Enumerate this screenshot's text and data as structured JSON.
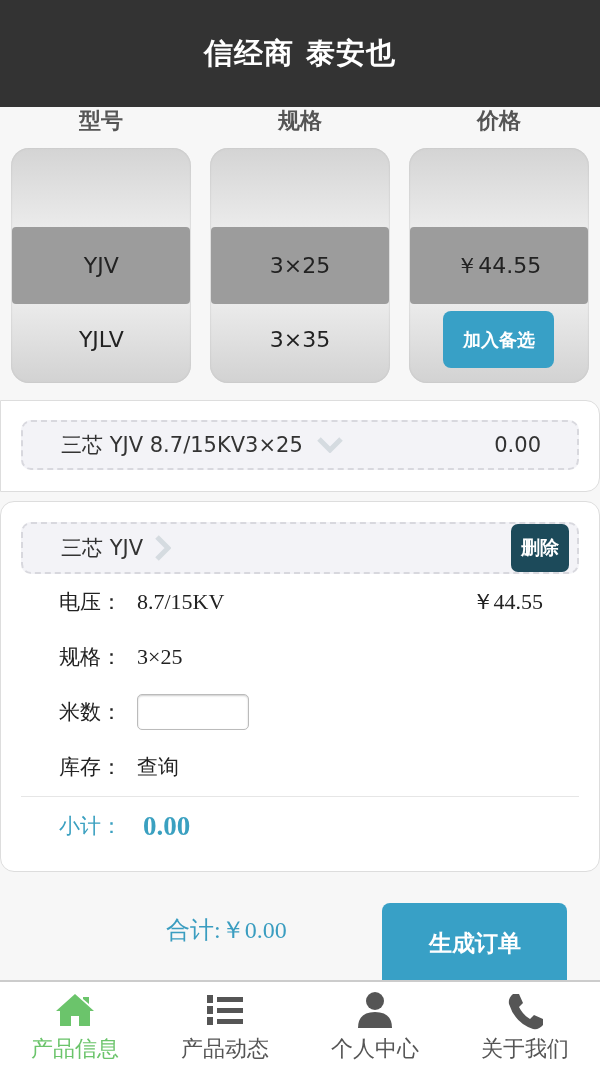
{
  "title": "信经商 泰安也",
  "columns": [
    {
      "kind": "options",
      "heading": "型号",
      "options": [
        {
          "label": "YJV",
          "selected": true
        },
        {
          "label": "YJLV",
          "selected": false
        }
      ]
    },
    {
      "kind": "options",
      "heading": "规格",
      "options": [
        {
          "label": "3×25",
          "selected": true
        },
        {
          "label": "3×35",
          "selected": false
        }
      ]
    },
    {
      "kind": "price",
      "heading": "价格",
      "price": "￥44.55",
      "button": "加入备选"
    }
  ],
  "summary": {
    "label": "三芯 YJV 8.7/15KV3×25",
    "amount": "0.00",
    "expanded": true
  },
  "detail": {
    "title": "三芯 YJV",
    "expanded": false,
    "delete_button": "删除",
    "fields": [
      {
        "kind": "text",
        "label": "电压：",
        "value": "8.7/15KV",
        "price": "￥44.55"
      },
      {
        "kind": "text",
        "label": "规格：",
        "value": "3×25"
      },
      {
        "kind": "input",
        "label": "米数："
      },
      {
        "kind": "link",
        "label": "库存：",
        "value": "查询"
      }
    ],
    "subtotal_label": "小计：",
    "subtotal": "0.00"
  },
  "total": "合计:￥0.00",
  "order_button": "生成订单",
  "tabs": [
    {
      "label": "产品信息",
      "selected": true
    },
    {
      "label": "产品动态",
      "selected": false
    },
    {
      "label": "个人中心",
      "selected": false
    },
    {
      "label": "关于我们",
      "selected": false
    }
  ]
}
